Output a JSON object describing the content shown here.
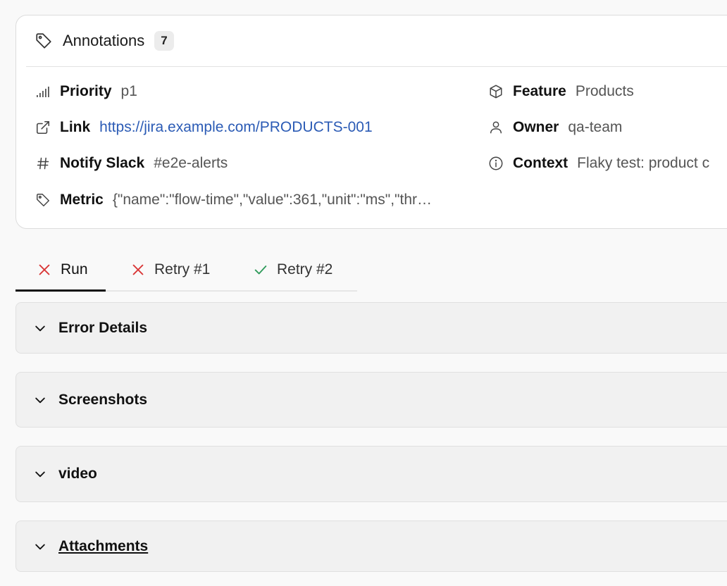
{
  "annotations": {
    "title": "Annotations",
    "count": "7",
    "items": [
      {
        "key": "Priority",
        "value": "p1",
        "icon": "signal-bars-icon"
      },
      {
        "key": "Feature",
        "value": "Products",
        "icon": "cube-icon"
      },
      {
        "key": "Link",
        "value": "https://jira.example.com/PRODUCTS-001",
        "icon": "external-link-icon"
      },
      {
        "key": "Owner",
        "value": "qa-team",
        "icon": "user-icon"
      },
      {
        "key": "Notify Slack",
        "value": "#e2e-alerts",
        "icon": "hash-icon"
      },
      {
        "key": "Context",
        "value": "Flaky test: product c",
        "icon": "info-icon"
      },
      {
        "key": "Metric",
        "value": "{\"name\":\"flow-time\",\"value\":361,\"unit\":\"ms\",\"thr…",
        "icon": "tag-icon"
      }
    ]
  },
  "tabs": [
    {
      "label": "Run",
      "status": "failed"
    },
    {
      "label": "Retry #1",
      "status": "failed"
    },
    {
      "label": "Retry #2",
      "status": "passed"
    }
  ],
  "sections": [
    {
      "title": "Error Details"
    },
    {
      "title": "Screenshots"
    },
    {
      "title": "video"
    },
    {
      "title": "Attachments"
    }
  ],
  "colors": {
    "fail": "#d93636",
    "pass": "#2e9a5a",
    "link": "#2b5bb5"
  }
}
